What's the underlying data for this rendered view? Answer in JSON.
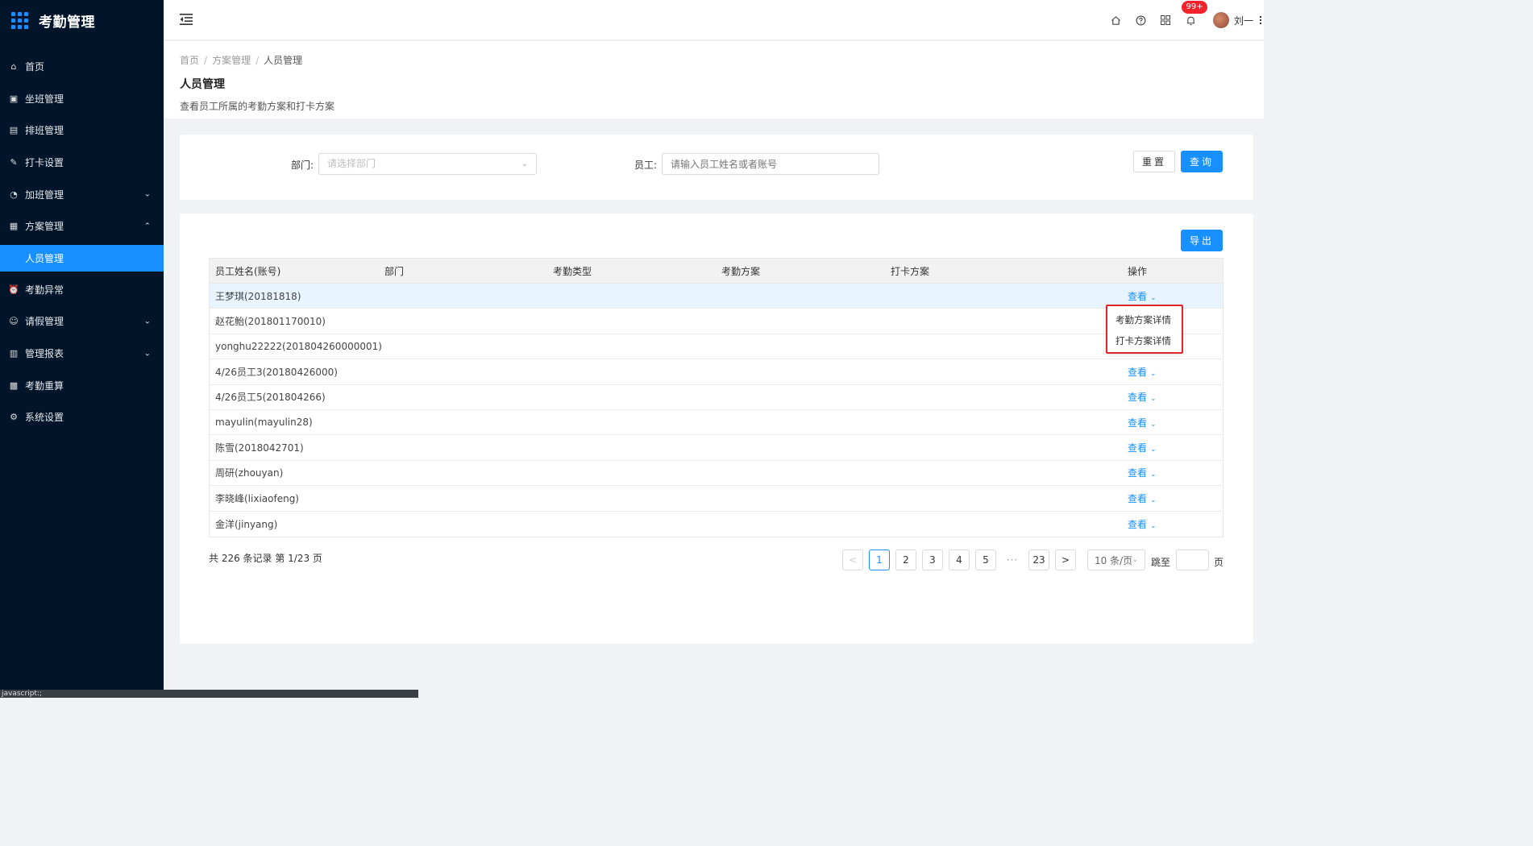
{
  "app": {
    "title": "考勤管理"
  },
  "sidebar": {
    "items": [
      {
        "label": "首页",
        "icon": "home-icon",
        "glyph": "⌂",
        "chevron": ""
      },
      {
        "label": "坐班管理",
        "icon": "calendar-check-icon",
        "glyph": "▣",
        "chevron": ""
      },
      {
        "label": "排班管理",
        "icon": "schedule-icon",
        "glyph": "▤",
        "chevron": ""
      },
      {
        "label": "打卡设置",
        "icon": "edit-icon",
        "glyph": "✎",
        "chevron": ""
      },
      {
        "label": "加班管理",
        "icon": "clock-icon",
        "glyph": "◔",
        "chevron": "⌄"
      },
      {
        "label": "方案管理",
        "icon": "document-icon",
        "glyph": "▦",
        "chevron": "⌃"
      },
      {
        "label": "人员管理",
        "icon": "",
        "glyph": "",
        "chevron": "",
        "active": true
      },
      {
        "label": "考勤异常",
        "icon": "alarm-icon",
        "glyph": "⏰",
        "chevron": ""
      },
      {
        "label": "请假管理",
        "icon": "leave-icon",
        "glyph": "☺",
        "chevron": "⌄"
      },
      {
        "label": "管理报表",
        "icon": "report-icon",
        "glyph": "▥",
        "chevron": "⌄"
      },
      {
        "label": "考勤重算",
        "icon": "calculator-icon",
        "glyph": "▩",
        "chevron": ""
      },
      {
        "label": "系统设置",
        "icon": "gear-icon",
        "glyph": "⚙",
        "chevron": ""
      }
    ]
  },
  "header": {
    "badge": "99+",
    "user_name": "刘一"
  },
  "breadcrumb": {
    "home": "首页",
    "parent": "方案管理",
    "current": "人员管理",
    "sep": "/"
  },
  "page": {
    "title": "人员管理",
    "desc": "查看员工所属的考勤方案和打卡方案"
  },
  "filter": {
    "dept_label": "部门:",
    "dept_placeholder": "请选择部门",
    "emp_label": "员工:",
    "emp_placeholder": "请输入员工姓名或者账号",
    "reset_label": "重置",
    "query_label": "查询"
  },
  "toolbar": {
    "export_label": "导出"
  },
  "table": {
    "columns": [
      "员工姓名(账号)",
      "部门",
      "考勤类型",
      "考勤方案",
      "打卡方案",
      "操作"
    ],
    "op_label": "查看",
    "rows": [
      {
        "name": "王梦琪(20181818)",
        "op": true
      },
      {
        "name": "赵花鲐(201801170010)",
        "op": false
      },
      {
        "name": "yonghu22222(201804260000001)",
        "op": false
      },
      {
        "name": "4/26员工3(20180426000)",
        "op": true
      },
      {
        "name": "4/26员工5(201804266)",
        "op": true
      },
      {
        "name": "mayulin(mayulin28)",
        "op": true
      },
      {
        "name": "陈雪(2018042701)",
        "op": true
      },
      {
        "name": "周研(zhouyan)",
        "op": true
      },
      {
        "name": "李晓峰(lixiaofeng)",
        "op": true
      },
      {
        "name": "金洋(jinyang)",
        "op": true
      }
    ]
  },
  "dropdown": {
    "items": [
      "考勤方案详情",
      "打卡方案详情"
    ]
  },
  "pagination": {
    "total_text": "共 226 条记录 第 1/23 页",
    "pages": [
      "1",
      "2",
      "3",
      "4",
      "5"
    ],
    "ellipsis": "···",
    "last_page": "23",
    "page_size": "10 条/页",
    "jump_label": "跳至",
    "page_suffix": "页",
    "prev": "<",
    "next": ">"
  },
  "status_tip": "javascript:;"
}
